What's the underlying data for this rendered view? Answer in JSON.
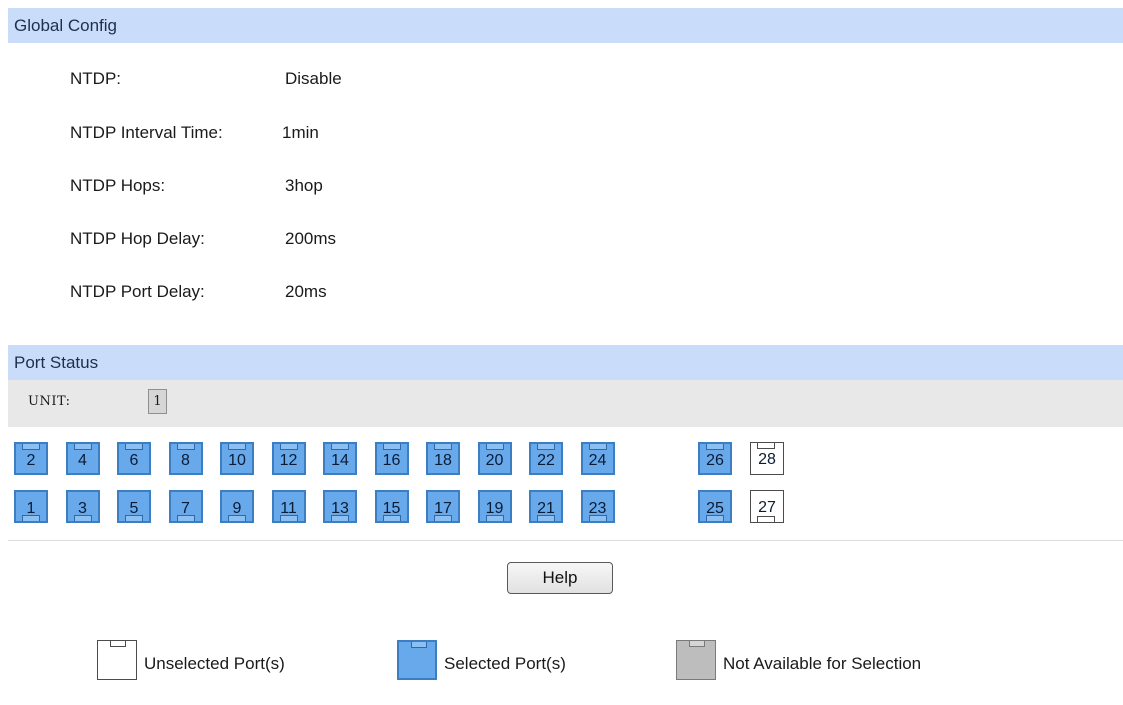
{
  "global_config": {
    "header": "Global Config",
    "rows": [
      {
        "label": "NTDP:",
        "value": "Disable"
      },
      {
        "label": "NTDP Interval Time:",
        "value": "1min"
      },
      {
        "label": "NTDP Hops:",
        "value": "3hop"
      },
      {
        "label": "NTDP Hop Delay:",
        "value": "200ms"
      },
      {
        "label": "NTDP Port Delay:",
        "value": "20ms"
      }
    ]
  },
  "port_status": {
    "header": "Port Status",
    "unit_label": "UNIT:",
    "unit_value": "1",
    "top_row": [
      {
        "num": "2",
        "state": "selected"
      },
      {
        "num": "4",
        "state": "selected"
      },
      {
        "num": "6",
        "state": "selected"
      },
      {
        "num": "8",
        "state": "selected"
      },
      {
        "num": "10",
        "state": "selected"
      },
      {
        "num": "12",
        "state": "selected"
      },
      {
        "num": "14",
        "state": "selected"
      },
      {
        "num": "16",
        "state": "selected"
      },
      {
        "num": "18",
        "state": "selected"
      },
      {
        "num": "20",
        "state": "selected"
      },
      {
        "num": "22",
        "state": "selected"
      },
      {
        "num": "24",
        "state": "selected"
      },
      {
        "num": "26",
        "state": "selected"
      },
      {
        "num": "28",
        "state": "unselected"
      }
    ],
    "bottom_row": [
      {
        "num": "1",
        "state": "selected"
      },
      {
        "num": "3",
        "state": "selected"
      },
      {
        "num": "5",
        "state": "selected"
      },
      {
        "num": "7",
        "state": "selected"
      },
      {
        "num": "9",
        "state": "selected"
      },
      {
        "num": "11",
        "state": "selected"
      },
      {
        "num": "13",
        "state": "selected"
      },
      {
        "num": "15",
        "state": "selected"
      },
      {
        "num": "17",
        "state": "selected"
      },
      {
        "num": "19",
        "state": "selected"
      },
      {
        "num": "21",
        "state": "selected"
      },
      {
        "num": "23",
        "state": "selected"
      },
      {
        "num": "25",
        "state": "selected"
      },
      {
        "num": "27",
        "state": "unselected"
      }
    ]
  },
  "help_label": "Help",
  "legend": [
    {
      "label": "Unselected Port(s)",
      "icon": "port-unselected-icon"
    },
    {
      "label": "Selected Port(s)",
      "icon": "port-selected-icon"
    },
    {
      "label": "Not Available for Selection",
      "icon": "port-unavailable-icon"
    }
  ],
  "colors": {
    "header_bg": "#c9dcf9",
    "selected_port": "#68a9ec",
    "unavailable_port": "#bdbdbd",
    "unit_bar_bg": "#e8e8e8"
  }
}
